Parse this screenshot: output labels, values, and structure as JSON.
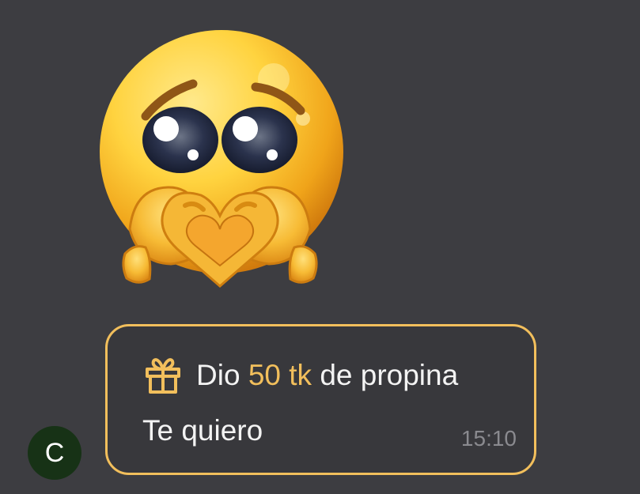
{
  "sticker": {
    "icon": "pleading-heart-hands-icon"
  },
  "tip": {
    "prefix": "Dio",
    "amount": "50 tk",
    "suffix": "de propina",
    "icon": "gift-icon"
  },
  "message": {
    "text": "Te quiero",
    "time": "15:10"
  },
  "avatar": {
    "initial": "C",
    "color": "#173216"
  },
  "colors": {
    "background": "#3d3d41",
    "accent": "#f2bf5c",
    "text": "#f3f3f3",
    "timestamp": "#8a8a8f"
  }
}
